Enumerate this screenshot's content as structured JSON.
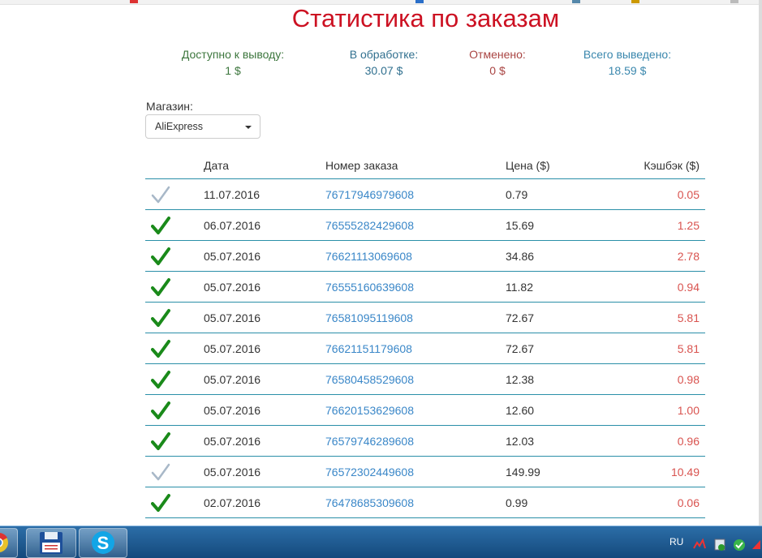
{
  "title": "Статистика по заказам",
  "stats": [
    {
      "label": "Доступно к выводу:",
      "value": "1 $",
      "color": "#3c763d"
    },
    {
      "label": "В обработке:",
      "value": "30.07 $",
      "color": "#31708f"
    },
    {
      "label": "Отменено:",
      "value": "0 $",
      "color": "#a94442"
    },
    {
      "label": "Всего выведено:",
      "value": "18.59 $",
      "color": "#3a87ad"
    }
  ],
  "shop": {
    "label": "Магазин:",
    "selected": "AliExpress"
  },
  "table": {
    "headers": {
      "date": "Дата",
      "order": "Номер заказа",
      "price": "Цена ($)",
      "cashback": "Кэшбэк ($)"
    },
    "rows": [
      {
        "status": "pending",
        "date": "11.07.2016",
        "order": "76717946979608",
        "price": "0.79",
        "cashback": "0.05"
      },
      {
        "status": "confirmed",
        "date": "06.07.2016",
        "order": "76555282429608",
        "price": "15.69",
        "cashback": "1.25"
      },
      {
        "status": "confirmed",
        "date": "05.07.2016",
        "order": "76621113069608",
        "price": "34.86",
        "cashback": "2.78"
      },
      {
        "status": "confirmed",
        "date": "05.07.2016",
        "order": "76555160639608",
        "price": "11.82",
        "cashback": "0.94"
      },
      {
        "status": "confirmed",
        "date": "05.07.2016",
        "order": "76581095119608",
        "price": "72.67",
        "cashback": "5.81"
      },
      {
        "status": "confirmed",
        "date": "05.07.2016",
        "order": "76621151179608",
        "price": "72.67",
        "cashback": "5.81"
      },
      {
        "status": "confirmed",
        "date": "05.07.2016",
        "order": "76580458529608",
        "price": "12.38",
        "cashback": "0.98"
      },
      {
        "status": "confirmed",
        "date": "05.07.2016",
        "order": "76620153629608",
        "price": "12.60",
        "cashback": "1.00"
      },
      {
        "status": "confirmed",
        "date": "05.07.2016",
        "order": "76579746289608",
        "price": "12.03",
        "cashback": "0.96"
      },
      {
        "status": "pending",
        "date": "05.07.2016",
        "order": "76572302449608",
        "price": "149.99",
        "cashback": "10.49"
      },
      {
        "status": "confirmed",
        "date": "02.07.2016",
        "order": "76478685309608",
        "price": "0.99",
        "cashback": "0.06"
      }
    ]
  },
  "taskbar": {
    "apps": [
      "chrome-icon",
      "save-disk-icon",
      "skype-icon"
    ],
    "skype_letter": "S",
    "lang": "RU",
    "tray": [
      "network-icon",
      "security-icon",
      "update-icon",
      "arrow-icon"
    ]
  },
  "colors": {
    "title": "#cc1122",
    "link": "#3a87c8",
    "cashback": "#d9534f",
    "row_border": "#2a8fa8",
    "check_confirmed": "#1a8a1a",
    "check_pending": "#a8b8c8"
  }
}
